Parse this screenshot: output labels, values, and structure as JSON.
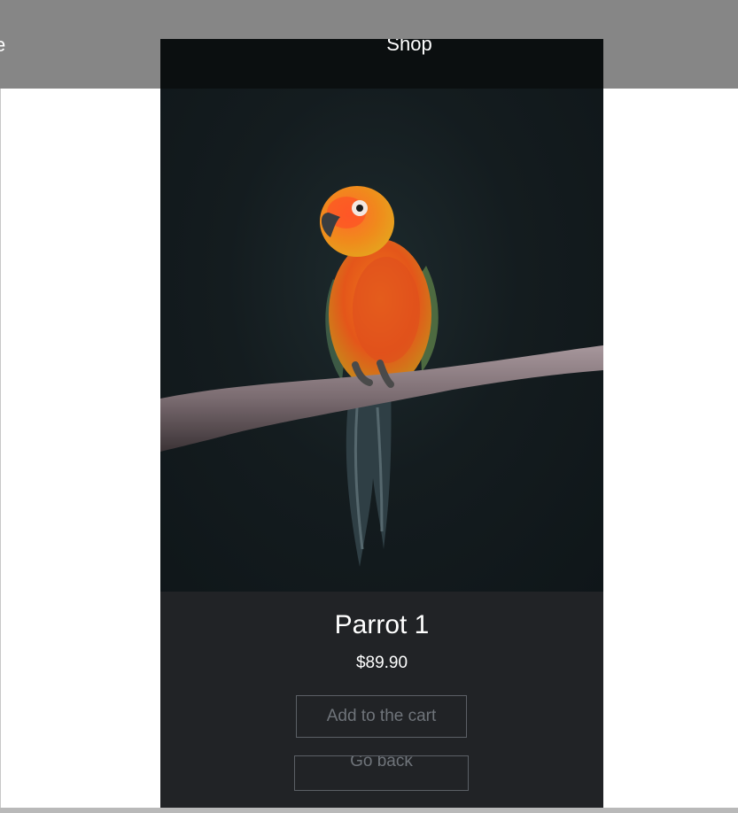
{
  "nav": {
    "left_text": "e",
    "shop_label": "Shop"
  },
  "product": {
    "image_alt": "parrot-photo",
    "title": "Parrot 1",
    "price": "$89.90"
  },
  "actions": {
    "add_to_cart_label": "Add to the cart",
    "go_back_label": "Go back"
  },
  "colors": {
    "topbar": "#868686",
    "card_background": "#212326",
    "header_background": "#0b0f10",
    "button_border": "#5c6066",
    "button_text": "#6f747a"
  }
}
